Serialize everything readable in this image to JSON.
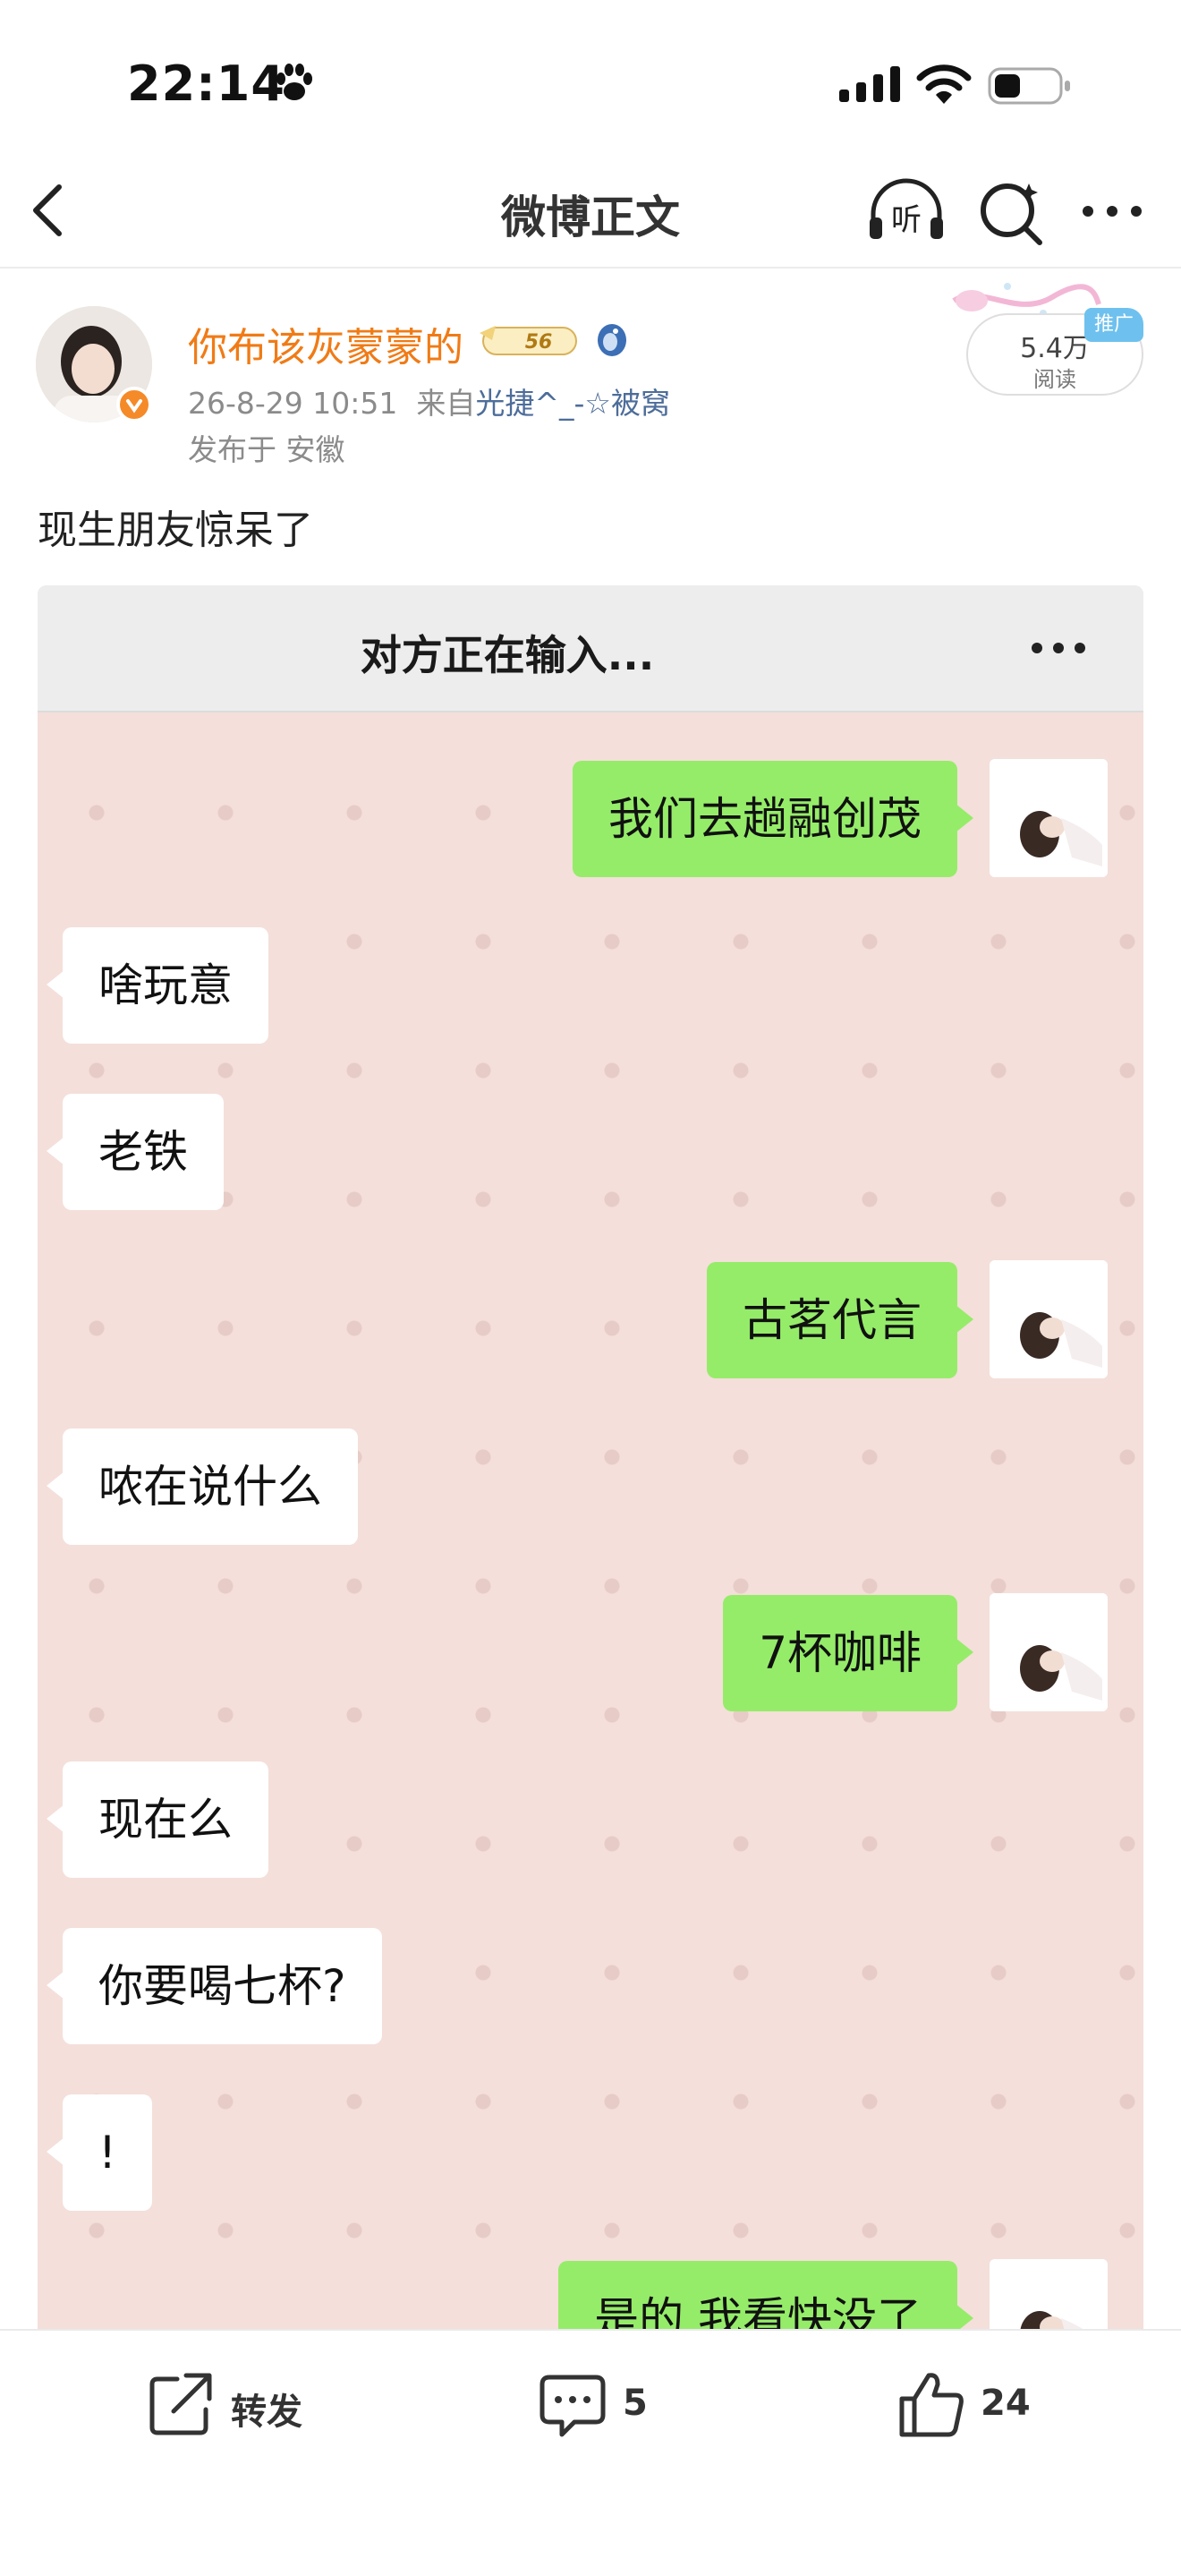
{
  "status_bar": {
    "time": "22:14"
  },
  "nav": {
    "title": "微博正文",
    "listen_label": "听"
  },
  "post": {
    "author_name": "你布该灰蒙蒙的",
    "member_level": "56",
    "timestamp": "26-8-29 10:51",
    "source_prefix": "来自",
    "source_name": "光捷^_-☆被窝",
    "location": "发布于 安徽",
    "read_count": "5.4万",
    "read_label": "阅读",
    "ad_tag": "推广",
    "text": "现生朋友惊呆了"
  },
  "chat": {
    "title": "对方正在输入...",
    "messages": [
      {
        "side": "right",
        "text": "我们去趟融创茂"
      },
      {
        "side": "left",
        "text": "啥玩意"
      },
      {
        "side": "left",
        "text": "老铁"
      },
      {
        "side": "right",
        "text": "古茗代言"
      },
      {
        "side": "left",
        "text": "哝在说什么"
      },
      {
        "side": "right",
        "text": "7杯咖啡"
      },
      {
        "side": "left",
        "text": "现在么"
      },
      {
        "side": "left",
        "text": "你要喝七杯?"
      },
      {
        "side": "left",
        "text": "!"
      },
      {
        "side": "right",
        "text": "是的 我看快没了"
      }
    ]
  },
  "actions": {
    "repost_label": "转发",
    "comment_count": "5",
    "like_count": "24"
  },
  "colors": {
    "author_orange": "#f07b16",
    "source_blue": "#4d6d9a",
    "bubble_green": "#95ec69",
    "chat_bg_pink": "#f4dfda"
  }
}
